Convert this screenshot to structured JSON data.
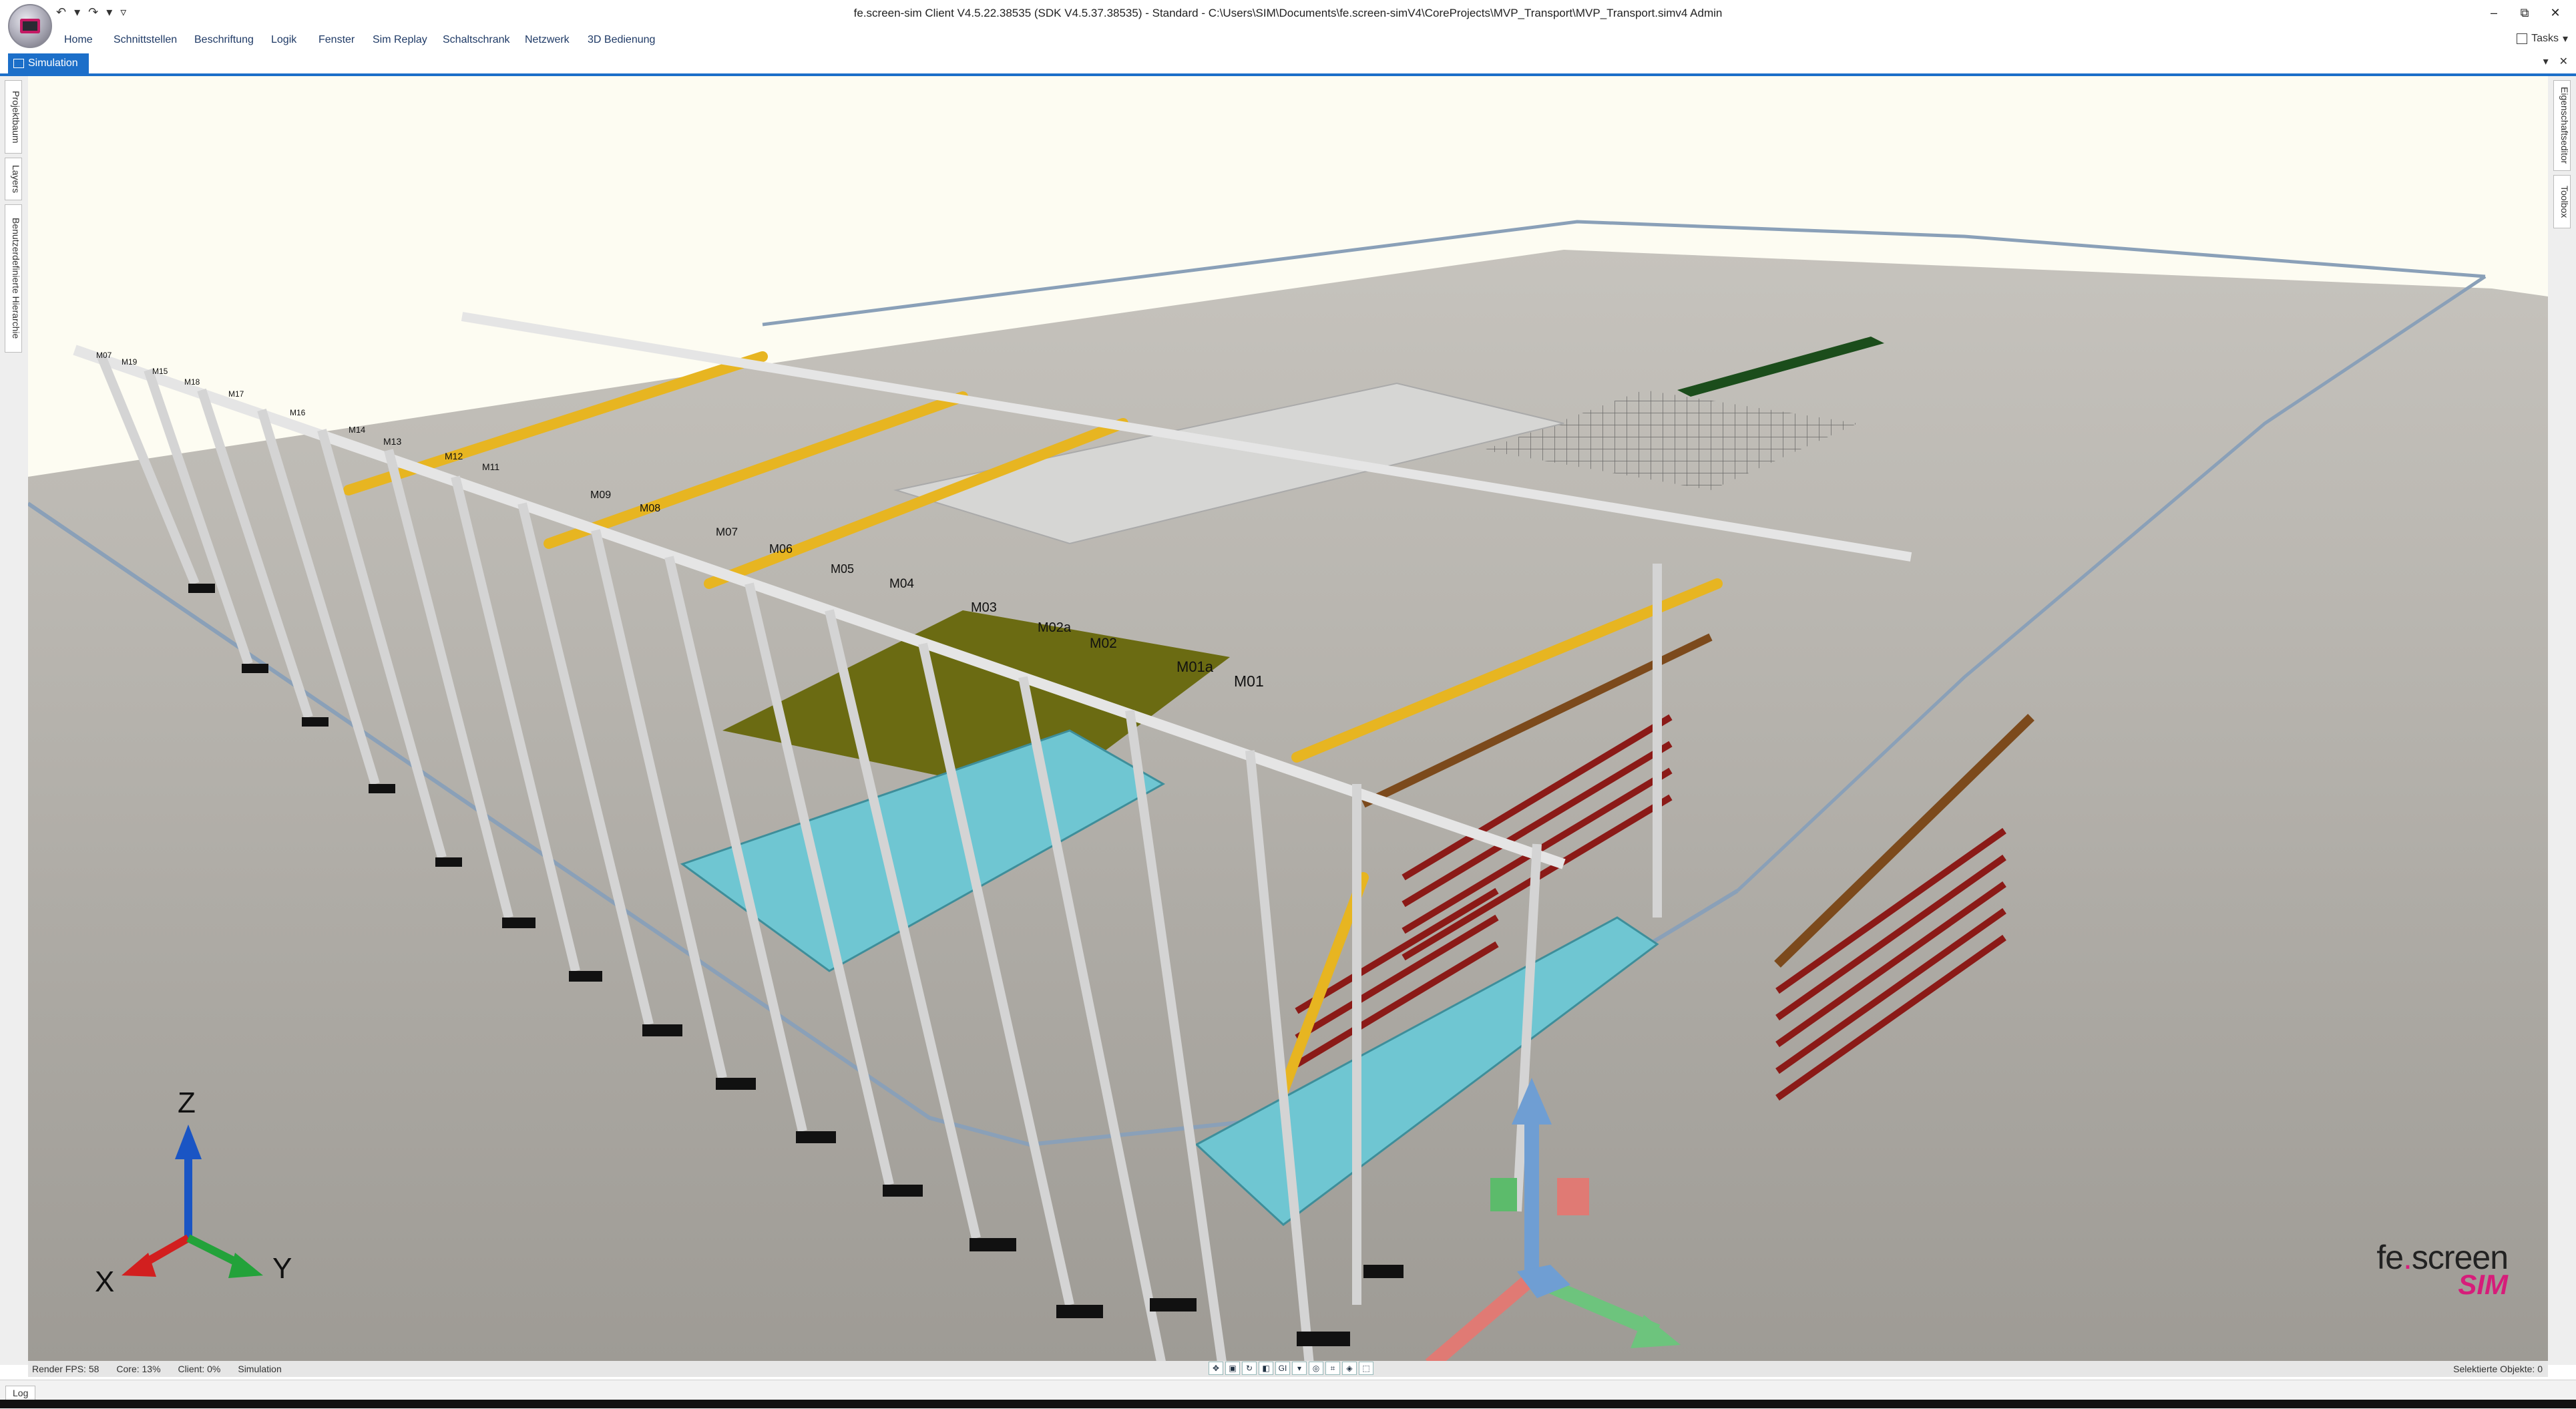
{
  "window": {
    "title": "fe.screen-sim Client V4.5.22.38535    (SDK V4.5.37.38535) - Standard - C:\\Users\\SIM\\Documents\\fe.screen-simV4\\CoreProjects\\MVP_Transport\\MVP_Transport.simv4 Admin",
    "controls": [
      "–",
      "⧉",
      "✕"
    ]
  },
  "quick_access": [
    "↶",
    "▾",
    "↷",
    "▾",
    "▿"
  ],
  "menu": {
    "items": [
      "Home",
      "Schnittstellen",
      "Beschriftung",
      "Logik",
      "Fenster",
      "Sim Replay",
      "Schaltschrank",
      "Netzwerk",
      "3D Bedienung"
    ],
    "tasks_label": "Tasks"
  },
  "doc_tab": {
    "label": "Simulation",
    "buttons": [
      "▾",
      "✕"
    ]
  },
  "left_panels": [
    "Projektbaum",
    "Layers",
    "Benutzerdefinierte Hierarchie"
  ],
  "right_panels": [
    "Eigenschaftseditor",
    "Toolbox"
  ],
  "scene": {
    "station_labels": [
      "M07",
      "M19",
      "M15",
      "M18",
      "M17",
      "M16",
      "M14",
      "M13",
      "M12",
      "M11",
      "M09",
      "M08",
      "M07",
      "M06",
      "M05",
      "M04",
      "M03",
      "M02a",
      "M02",
      "M01a",
      "M01"
    ],
    "axes": {
      "z": "Z",
      "x": "X",
      "y": "Y"
    },
    "colors": {
      "floor": "#a9a6a0",
      "sky": "#fdfcf2",
      "beam_gold": "#e7b521",
      "column_grey": "#cfcfcf",
      "basin_blue": "#6fc6d2",
      "rack_red": "#8b1a17",
      "rail_brown": "#7c4a1c",
      "olive_deck": "#6b6b12",
      "brand_pink": "#d61d7a"
    },
    "brand": {
      "main": "fe.screen",
      "sub": "SIM"
    }
  },
  "status": {
    "fps": "Render FPS: 58",
    "core": "Core: 13%",
    "client": "Client: 0%",
    "mode": "Simulation",
    "toolbar_icons": [
      "move",
      "scale",
      "rotate",
      "cam",
      "GI",
      "dropdown",
      "render",
      "grid",
      "snap",
      "view"
    ],
    "selected": "Selektierte Objekte: 0"
  },
  "log_tab": "Log"
}
